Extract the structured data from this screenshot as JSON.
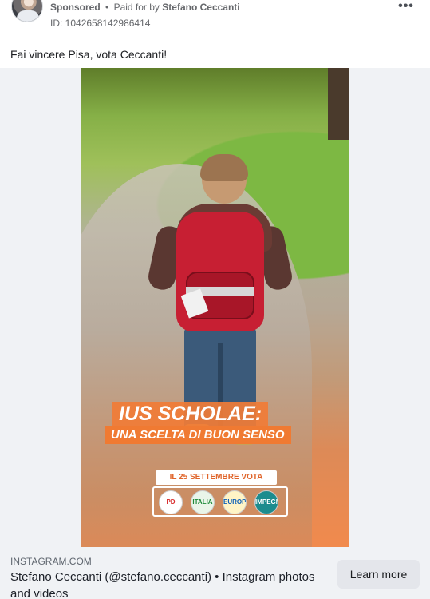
{
  "header": {
    "sponsored_label": "Sponsored",
    "separator": "•",
    "paid_for_prefix": "Paid for by",
    "payer_name": "Stefano Ceccanti",
    "ad_id": "ID: 1042658142986414",
    "more_glyph": "•••"
  },
  "post": {
    "caption": "Fai vincere Pisa, vota Ceccanti!"
  },
  "creative": {
    "headline": "IUS SCHOLAE:",
    "subheadline": "UNA SCELTA DI BUON SENSO",
    "vote_banner": "IL 25 SETTEMBRE VOTA",
    "logos": [
      "PD",
      "ITALIA DEMOCRATICA",
      "EUROPA",
      "IMPEGNO CIVICO"
    ],
    "colors": {
      "accent": "#f07a32",
      "backpack": "#c71f33",
      "grass": "#7db843"
    }
  },
  "link_preview": {
    "domain": "INSTAGRAM.COM",
    "title": "Stefano Ceccanti (@stefano.ceccanti) • Instagram photos and videos",
    "cta_label": "Learn more"
  },
  "icons": {
    "avatar": "profile-photo",
    "more": "more-horizontal-icon"
  }
}
